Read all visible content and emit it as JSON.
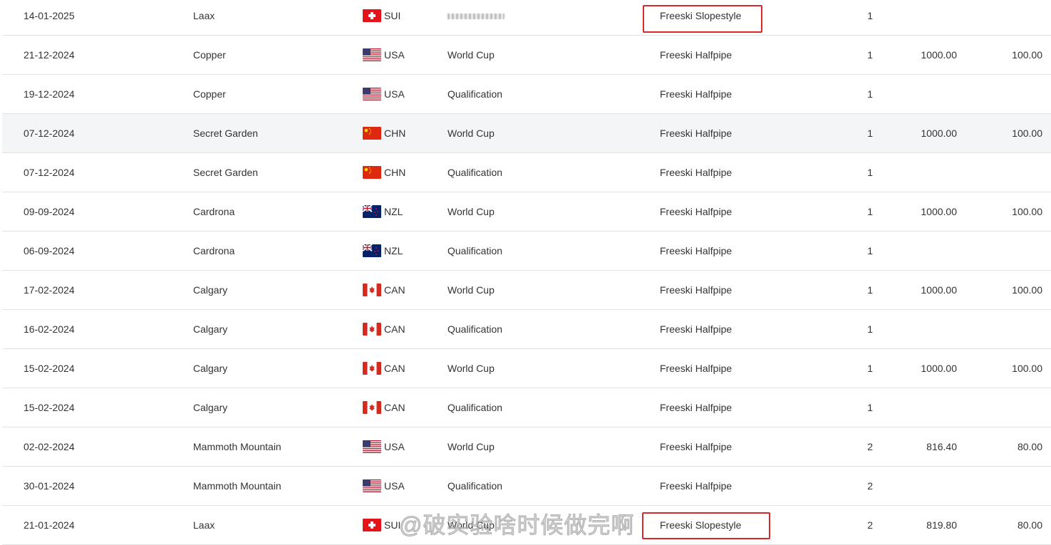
{
  "colors": {
    "highlight_box": "#d9282b",
    "hover_row": "#f4f5f6"
  },
  "rows": [
    {
      "date": "14-01-2025",
      "place": "Laax",
      "nation": "SUI",
      "category": "",
      "category_redacted": true,
      "discipline": "Freeski Slopestyle",
      "rank": "1",
      "points": "",
      "cup_points": "",
      "highlighted": true
    },
    {
      "date": "21-12-2024",
      "place": "Copper",
      "nation": "USA",
      "category": "World Cup",
      "discipline": "Freeski Halfpipe",
      "rank": "1",
      "points": "1000.00",
      "cup_points": "100.00"
    },
    {
      "date": "19-12-2024",
      "place": "Copper",
      "nation": "USA",
      "category": "Qualification",
      "discipline": "Freeski Halfpipe",
      "rank": "1",
      "points": "",
      "cup_points": ""
    },
    {
      "date": "07-12-2024",
      "place": "Secret Garden",
      "nation": "CHN",
      "category": "World Cup",
      "discipline": "Freeski Halfpipe",
      "rank": "1",
      "points": "1000.00",
      "cup_points": "100.00",
      "hover": true
    },
    {
      "date": "07-12-2024",
      "place": "Secret Garden",
      "nation": "CHN",
      "category": "Qualification",
      "discipline": "Freeski Halfpipe",
      "rank": "1",
      "points": "",
      "cup_points": ""
    },
    {
      "date": "09-09-2024",
      "place": "Cardrona",
      "nation": "NZL",
      "category": "World Cup",
      "discipline": "Freeski Halfpipe",
      "rank": "1",
      "points": "1000.00",
      "cup_points": "100.00"
    },
    {
      "date": "06-09-2024",
      "place": "Cardrona",
      "nation": "NZL",
      "category": "Qualification",
      "discipline": "Freeski Halfpipe",
      "rank": "1",
      "points": "",
      "cup_points": ""
    },
    {
      "date": "17-02-2024",
      "place": "Calgary",
      "nation": "CAN",
      "category": "World Cup",
      "discipline": "Freeski Halfpipe",
      "rank": "1",
      "points": "1000.00",
      "cup_points": "100.00"
    },
    {
      "date": "16-02-2024",
      "place": "Calgary",
      "nation": "CAN",
      "category": "Qualification",
      "discipline": "Freeski Halfpipe",
      "rank": "1",
      "points": "",
      "cup_points": ""
    },
    {
      "date": "15-02-2024",
      "place": "Calgary",
      "nation": "CAN",
      "category": "World Cup",
      "discipline": "Freeski Halfpipe",
      "rank": "1",
      "points": "1000.00",
      "cup_points": "100.00"
    },
    {
      "date": "15-02-2024",
      "place": "Calgary",
      "nation": "CAN",
      "category": "Qualification",
      "discipline": "Freeski Halfpipe",
      "rank": "1",
      "points": "",
      "cup_points": ""
    },
    {
      "date": "02-02-2024",
      "place": "Mammoth Mountain",
      "nation": "USA",
      "category": "World Cup",
      "discipline": "Freeski Halfpipe",
      "rank": "2",
      "points": "816.40",
      "cup_points": "80.00"
    },
    {
      "date": "30-01-2024",
      "place": "Mammoth Mountain",
      "nation": "USA",
      "category": "Qualification",
      "discipline": "Freeski Halfpipe",
      "rank": "2",
      "points": "",
      "cup_points": ""
    },
    {
      "date": "21-01-2024",
      "place": "Laax",
      "nation": "SUI",
      "category": "World Cup",
      "discipline": "Freeski Slopestyle",
      "rank": "2",
      "points": "819.80",
      "cup_points": "80.00",
      "highlighted": true
    }
  ],
  "watermark": "@破实验啥时候做完啊"
}
